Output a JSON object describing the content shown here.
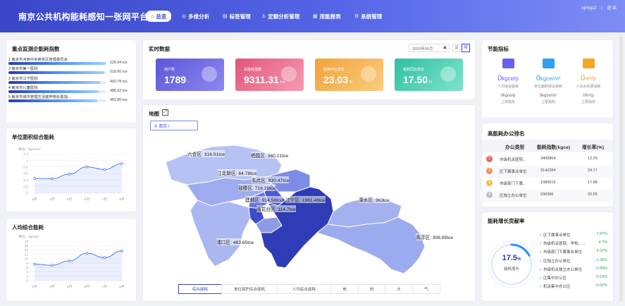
{
  "header": {
    "title": "南京公共机构能耗感知一张网平台",
    "nav": [
      {
        "label": "总览",
        "icon": "home-icon"
      },
      {
        "label": "多维分析",
        "icon": "target-icon"
      },
      {
        "label": "标签管理",
        "icon": "tag-icon"
      },
      {
        "label": "定额分析管理",
        "icon": "person-icon"
      },
      {
        "label": "用能报表",
        "icon": "report-icon"
      },
      {
        "label": "系统管理",
        "icon": "gear-icon"
      }
    ],
    "user": "njnhgz2",
    "logout": "退 出"
  },
  "ranking": {
    "title": "重点监测企能耗指数",
    "items": [
      {
        "label": "1 南京市河西中央商务区管理委员会",
        "value": "525.94 tce",
        "pct": 1.0
      },
      {
        "label": "2 南京市第一医院",
        "value": "518.66 tce",
        "pct": 0.986
      },
      {
        "label": "3 南京市江宁医院",
        "value": "493.78 tce",
        "pct": 0.939
      },
      {
        "label": "4 南京市儿童医院",
        "value": "486.62 tce",
        "pct": 0.925
      },
      {
        "label": "5 南京市城市管理生活废弃物处置指...",
        "value": "481.85 tce",
        "pct": 0.916
      }
    ]
  },
  "area_energy": {
    "title": "单位面积综合能耗",
    "unit": "单位：kgce/m²",
    "chart_data": {
      "type": "area",
      "categories": [
        "3月",
        "4月",
        "5月",
        "6月",
        "7月",
        "8月"
      ],
      "values": [
        0.45,
        0.44,
        0.58,
        0.8,
        0.72,
        0.9
      ],
      "ylim": [
        0,
        1.2
      ],
      "yticks": [
        "0",
        "0.2",
        "0.4",
        "0.6",
        "0.8",
        "1",
        "1.2"
      ],
      "grid": true
    }
  },
  "person_energy": {
    "title": "人均综合能耗",
    "unit": "单位：kgce/p",
    "chart_data": {
      "type": "area",
      "categories": [
        "3月",
        "4月",
        "5月",
        "6月",
        "7月",
        "8月"
      ],
      "values": [
        7.5,
        7,
        9,
        12.5,
        10.5,
        13.5
      ],
      "ylim": [
        0,
        18
      ],
      "yticks": [
        "0",
        "2",
        "4",
        "6",
        "8",
        "10",
        "12",
        "14",
        "16",
        "18"
      ],
      "grid": true
    }
  },
  "realtime": {
    "title": "实时数据",
    "date": "2020年06月",
    "toggle_left": "☰",
    "toggle_right": "月",
    "cards": [
      {
        "label": "用户数",
        "value": "1789",
        "unit": "↑",
        "color1": "#5b57d8",
        "color2": "#8e86f0",
        "icon": "user-icon"
      },
      {
        "label": "总能耗指数",
        "value": "9311.31",
        "unit": "tce",
        "color1": "#e25679",
        "color2": "#f59ab3",
        "icon": "chart-icon"
      },
      {
        "label": "能耗环比增长",
        "value": "23.03",
        "unit": "%",
        "color1": "#f3a23b",
        "color2": "#f8cc7c",
        "icon": "trend-icon"
      },
      {
        "label": "能耗同比增长",
        "value": "17.50",
        "unit": "%",
        "color1": "#2fc0a0",
        "color2": "#7ee3cb",
        "icon": "pie-icon"
      }
    ]
  },
  "map": {
    "title": "地图",
    "location": "南京 /",
    "districts": [
      {
        "name": "六合区: 316.91tce"
      },
      {
        "name": "栖霞区: 360.21tce"
      },
      {
        "name": "江北新区: 64.78tce"
      },
      {
        "name": "玄武区: 830.47tce"
      },
      {
        "name": "鼓楼区: 716.26tce"
      },
      {
        "name": "溧水区: 363tce"
      },
      {
        "name": "建邺区: 914.58tce"
      },
      {
        "name": "江宁区: 1961.46tce"
      },
      {
        "name": "雨花台区: 114.7tce"
      },
      {
        "name": "浦口区: 463.65tce"
      },
      {
        "name": "高淳区: 306.95tce"
      }
    ],
    "tabs": [
      "综合能耗",
      "单位面积综合能耗",
      "人均综合能耗",
      "电",
      "热",
      "水",
      "气"
    ]
  },
  "indicators": {
    "title": "节能指标",
    "items": [
      {
        "value": "0",
        "unit": "kgce/p",
        "label": "人均综合能耗",
        "limit": "0kgce/p",
        "limit_label": "上限指标",
        "color": "#6b5ff0",
        "icon": "person-chart-icon"
      },
      {
        "value": "0",
        "unit": "kgce/m²",
        "label": "单位面积综合能耗",
        "limit": "0kgce/m²",
        "limit_label": "上限指标",
        "color": "#2fa2ef",
        "icon": "building-chart-icon"
      },
      {
        "value": "0",
        "unit": "m³/p",
        "label": "人均水资源消耗",
        "limit": "0m³/p",
        "limit_label": "上限指标",
        "color": "#f5a623",
        "icon": "water-chart-icon"
      }
    ]
  },
  "office_rank": {
    "title": "高能耗办公排名",
    "headers": [
      "办公类型",
      "能耗指数(kgce)",
      "增长率(%)"
    ],
    "rows": [
      {
        "no": "1",
        "type": "市级机关医院...",
        "index": "3400804",
        "rate": "12.29",
        "color": "#e36a5c"
      },
      {
        "no": "2",
        "type": "区下属事业单位",
        "index": "3142394",
        "rate": "24.77",
        "color": "#f0914b"
      },
      {
        "no": "3",
        "type": "市级部门下属...",
        "index": "1080616",
        "rate": "17.88",
        "color": "#f2bb4c"
      },
      {
        "no": "4",
        "type": "区独立办公单位",
        "index": "630366",
        "rate": "20.55",
        "color": "#bfbfbf"
      }
    ]
  },
  "growth": {
    "title": "能耗增长贡献率",
    "gauge_value": "17.5",
    "gauge_unit": "%",
    "gauge_label": "能耗增长",
    "gauge_pct": 0.175,
    "items": [
      {
        "name": "区下属事业单位",
        "value": "7.87%"
      },
      {
        "name": "市级机关医院、学校、...",
        "value": "4.7%"
      },
      {
        "name": "市级部门下属事业单位",
        "value": "2.07%"
      },
      {
        "name": "区独立办公单位",
        "value": "1.36%"
      },
      {
        "name": "市级机关独立办公单位",
        "value": "0.89%"
      },
      {
        "name": "区集中办公区",
        "value": "0.63%"
      },
      {
        "name": "机关集中办公区",
        "value": "-0.02%"
      }
    ]
  }
}
